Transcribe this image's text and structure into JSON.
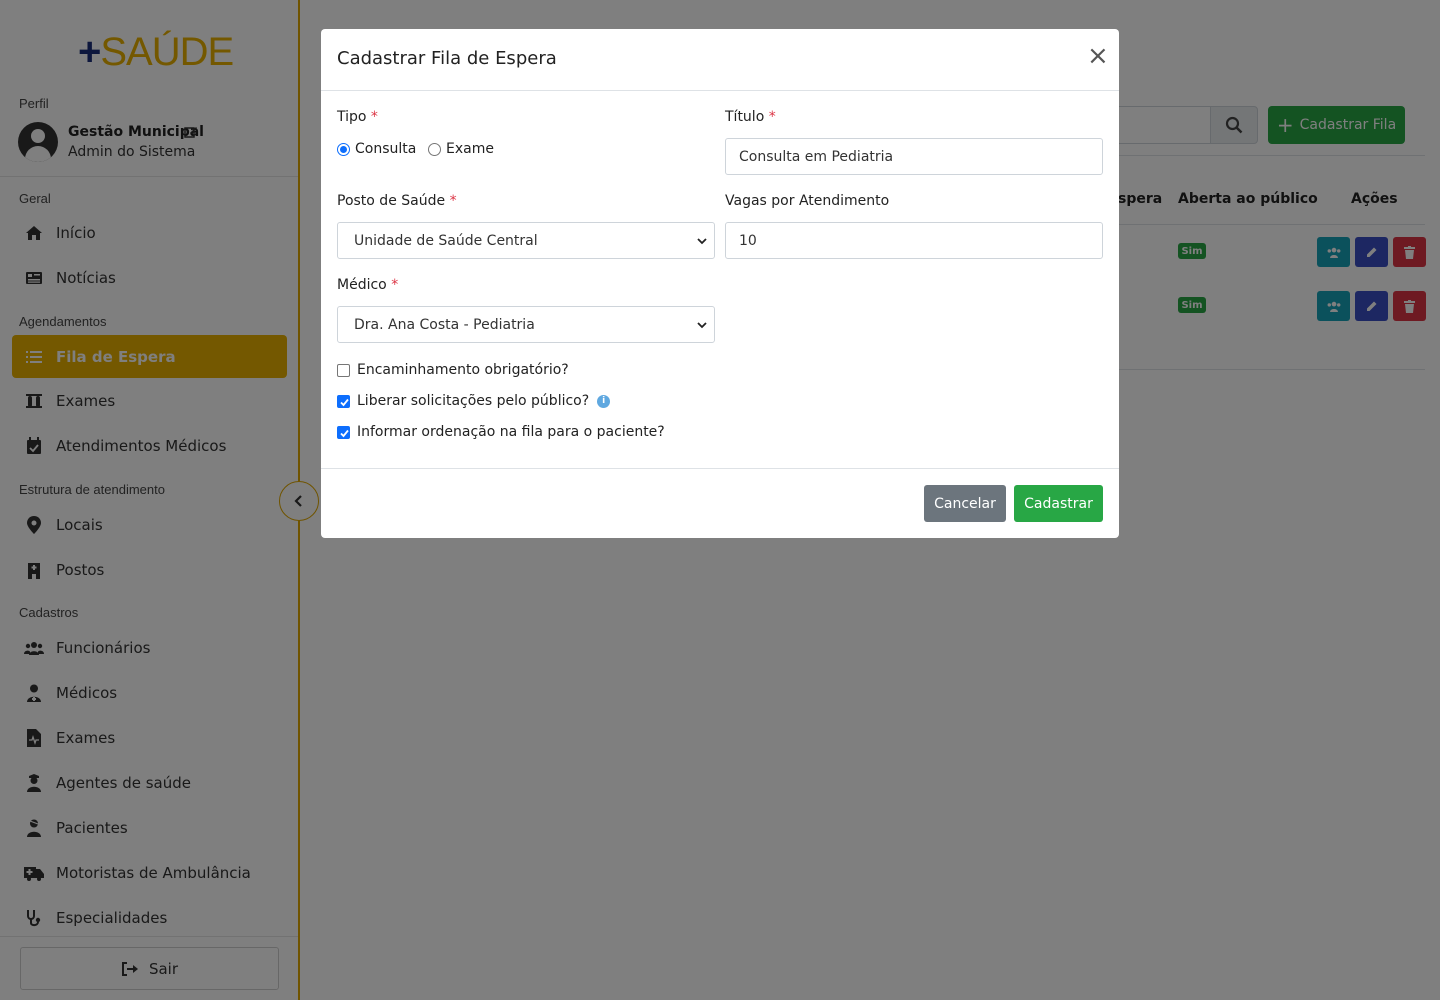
{
  "logo": {
    "plus": "+",
    "word": "SAÚDE"
  },
  "sidebar": {
    "profile_label": "Perfil",
    "profile_name": "Gestão Municipal",
    "profile_role": "Admin do Sistema",
    "sections": {
      "geral": "Geral",
      "agendamentos": "Agendamentos",
      "estrutura": "Estrutura de atendimento",
      "cadastros": "Cadastros"
    },
    "items": [
      {
        "label": "Início",
        "icon": "home-icon"
      },
      {
        "label": "Notícias",
        "icon": "newspaper-icon"
      },
      {
        "label": "Fila de Espera",
        "icon": "list-icon",
        "active": true
      },
      {
        "label": "Exames",
        "icon": "vials-icon"
      },
      {
        "label": "Atendimentos Médicos",
        "icon": "calendar-check-icon"
      },
      {
        "label": "Locais",
        "icon": "map-marker-icon"
      },
      {
        "label": "Postos",
        "icon": "hospital-icon"
      },
      {
        "label": "Funcionários",
        "icon": "users-icon"
      },
      {
        "label": "Médicos",
        "icon": "user-doctor-icon"
      },
      {
        "label": "Exames",
        "icon": "file-medical-icon"
      },
      {
        "label": "Agentes de saúde",
        "icon": "user-nurse-icon"
      },
      {
        "label": "Pacientes",
        "icon": "user-injured-icon"
      },
      {
        "label": "Motoristas de Ambulância",
        "icon": "ambulance-icon"
      },
      {
        "label": "Especialidades",
        "icon": "stethoscope-icon"
      }
    ],
    "logout_label": "Sair"
  },
  "background": {
    "add_button": "Cadastrar Fila",
    "table_headers": [
      "spera",
      "Aberta ao público",
      "Ações"
    ],
    "rows": [
      {
        "aberta": "Sim"
      },
      {
        "aberta": "Sim"
      }
    ]
  },
  "modal": {
    "title": "Cadastrar Fila de Espera",
    "close": "×",
    "tipo_label": "Tipo",
    "tipo_options": [
      "Consulta",
      "Exame"
    ],
    "tipo_selected": "Consulta",
    "titulo_label": "Título",
    "titulo_value": "Consulta em Pediatria",
    "posto_label": "Posto de Saúde",
    "posto_value": "Unidade de Saúde Central",
    "vagas_label": "Vagas por Atendimento",
    "vagas_value": "10",
    "medico_label": "Médico",
    "medico_value": "Dra. Ana Costa - Pediatria",
    "required_mark": "*",
    "checkboxes": [
      {
        "label": "Encaminhamento obrigatório?",
        "checked": false
      },
      {
        "label": "Liberar solicitações pelo público?",
        "checked": true
      },
      {
        "label": "Informar ordenação na fila para o paciente?",
        "checked": true
      }
    ],
    "info_glyph": "i",
    "cancel": "Cancelar",
    "submit": "Cadastrar"
  },
  "colors": {
    "accent": "#e8b100",
    "primary_green": "#28a745",
    "secondary": "#6c757d",
    "brand_blue": "#1b2f7a"
  }
}
